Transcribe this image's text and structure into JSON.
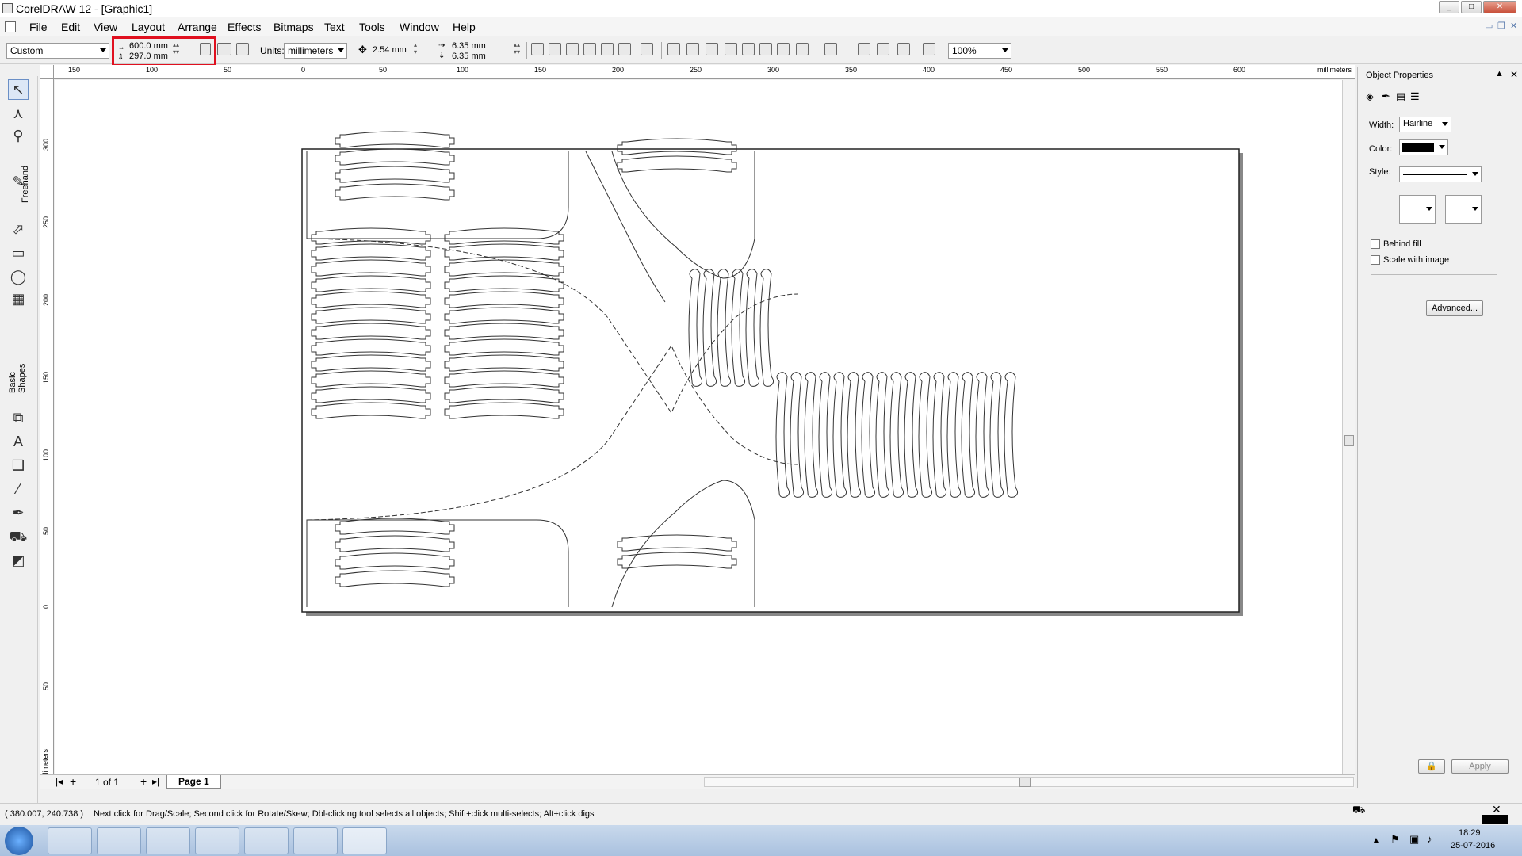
{
  "window": {
    "title": "CorelDRAW 12 - [Graphic1]",
    "min": "_",
    "max": "□",
    "close": "✕"
  },
  "menu": [
    "File",
    "Edit",
    "View",
    "Layout",
    "Arrange",
    "Effects",
    "Bitmaps",
    "Text",
    "Tools",
    "Window",
    "Help"
  ],
  "propertybar": {
    "preset": "Custom",
    "width": "600.0 mm",
    "height": "297.0 mm",
    "units_label": "Units:",
    "units": "millimeters",
    "nudge": "2.54 mm",
    "dup_x": "6.35 mm",
    "dup_y": "6.35 mm",
    "zoom": "100%"
  },
  "ruler": {
    "unit": "millimeters",
    "h_ticks": [
      "150",
      "100",
      "50",
      "0",
      "50",
      "100",
      "150",
      "200",
      "250",
      "300",
      "350",
      "400",
      "450",
      "500",
      "550",
      "600"
    ],
    "v_ticks": [
      "300",
      "250",
      "200",
      "150",
      "100",
      "50",
      "0",
      "50"
    ]
  },
  "toolbox": {
    "freehand_label": "Freehand",
    "basic_shapes_label": "Basic Shapes"
  },
  "pages": {
    "count": "1 of 1",
    "tab": "Page 1"
  },
  "docker": {
    "title": "Object Properties",
    "width_label": "Width:",
    "width_value": "Hairline",
    "color_label": "Color:",
    "style_label": "Style:",
    "behind_fill": "Behind fill",
    "scale_with_image": "Scale with image",
    "advanced": "Advanced...",
    "apply": "Apply"
  },
  "status": {
    "coords": "( 380.007, 240.738 )",
    "hint": "Next click for Drag/Scale; Second click for Rotate/Skew; Dbl-clicking tool selects all objects; Shift+click multi-selects; Alt+click digs"
  },
  "taskbar": {
    "time": "18:29",
    "date": "25-07-2016"
  },
  "colors": {
    "highlight": "#e0101f",
    "paper": "#ffffff",
    "outline": "#333333"
  }
}
